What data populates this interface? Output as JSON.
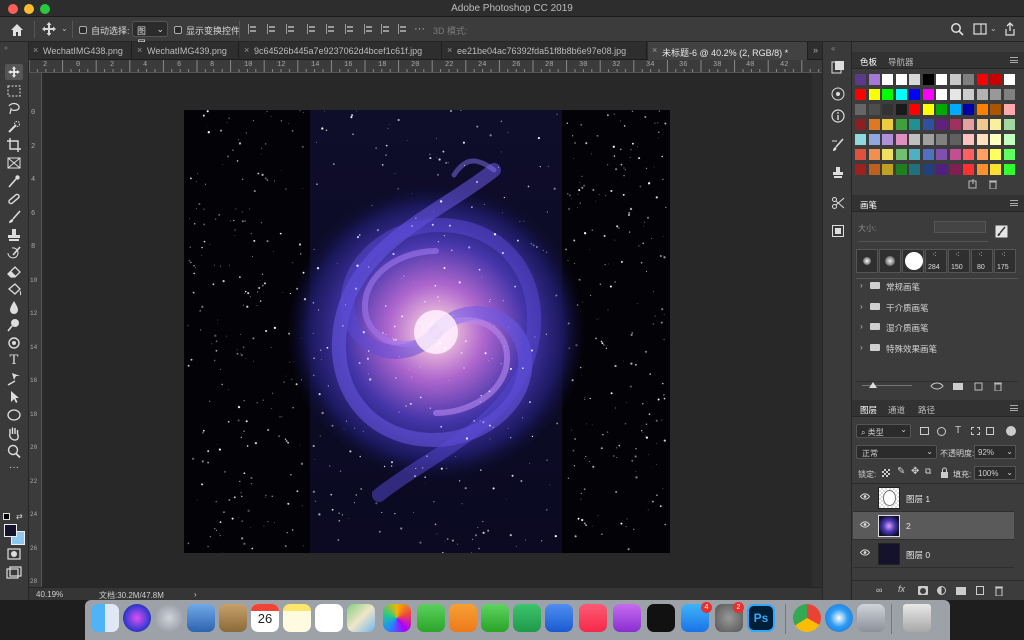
{
  "window": {
    "title": "Adobe Photoshop CC 2019"
  },
  "options_bar": {
    "auto_select_label": "自动选择:",
    "auto_select_value": "图层",
    "show_transform_label": "显示变换控件",
    "mode_3d_label": "3D 模式:"
  },
  "tabs": [
    {
      "label": "WechatIMG438.png",
      "active": false
    },
    {
      "label": "WechatIMG439.png",
      "active": false
    },
    {
      "label": "9c64526b445a7e9237062d4bcef1c61f.jpg",
      "active": false
    },
    {
      "label": "ee21be04ac76392fda51f8b8b6e97e08.jpg",
      "active": false
    },
    {
      "label": "未标题-6 @ 40.2% (2, RGB/8) *",
      "active": true
    }
  ],
  "rulers": {
    "top": [
      "2",
      "0",
      "2",
      "4",
      "6",
      "8",
      "10",
      "12",
      "14",
      "16",
      "18",
      "20",
      "22",
      "24",
      "26",
      "28",
      "30",
      "32",
      "34",
      "36",
      "38",
      "40",
      "42"
    ],
    "left": [
      "0",
      "2",
      "4",
      "6",
      "8",
      "10",
      "12",
      "14",
      "16",
      "18",
      "20",
      "22",
      "24",
      "26",
      "28"
    ]
  },
  "status": {
    "zoom": "40.19%",
    "doc_label": "文档:30.2M/47.8M"
  },
  "swatches_panel": {
    "tabs": [
      "色板",
      "导航器"
    ],
    "colors": [
      [
        "#5b3a8c",
        "#a478d8",
        "#ffffff",
        "#ffffff",
        "#d9d9d9",
        "#000000",
        "#ffffff",
        "#c8c8c8",
        "#7f7f7f",
        "#ff0000",
        "#c80000",
        "#ffffff"
      ],
      [
        "#ff0000",
        "#ffff00",
        "#00ff00",
        "#00ffff",
        "#0000ff",
        "#ff00ff",
        "#ffffff",
        "#e6e6e6",
        "#cccccc",
        "#b3b3b3",
        "#999999",
        "#808080"
      ],
      [
        "#666666",
        "#4d4d4d",
        "#333333",
        "#1a1a1a",
        "#ff0000",
        "#ffff00",
        "#00aa00",
        "#00aaff",
        "#0000aa",
        "#ff7f00",
        "#aa5500",
        "#ffaaaa"
      ],
      [
        "#8c2020",
        "#e07820",
        "#eecc40",
        "#40a040",
        "#209090",
        "#3050a0",
        "#602080",
        "#a03060",
        "#e4a0a0",
        "#f0c890",
        "#f8f0a0",
        "#a0d8a0"
      ],
      [
        "#90d8e0",
        "#90a8e0",
        "#b090d8",
        "#e090c0",
        "#c0c0c0",
        "#a0a0a0",
        "#808080",
        "#606060",
        "#ffc0c0",
        "#ffe0c0",
        "#ffffc0",
        "#c0ffc0"
      ],
      [
        "#e05040",
        "#f09050",
        "#f0e060",
        "#70c070",
        "#50b0c0",
        "#5070c0",
        "#8050b0",
        "#c05090",
        "#ff6060",
        "#ffa060",
        "#ffff60",
        "#60ff60"
      ],
      [
        "#a02020",
        "#c06020",
        "#c0a020",
        "#208020",
        "#207080",
        "#204080",
        "#502080",
        "#802050",
        "#ff3030",
        "#ff9030",
        "#ffe030",
        "#30ff30"
      ]
    ]
  },
  "brush_panel": {
    "tab": "画笔",
    "size_label": "大小:",
    "presets": [
      "",
      "",
      "",
      "284",
      "150",
      "80",
      "175"
    ],
    "groups": [
      "常规画笔",
      "干介质画笔",
      "湿介质画笔",
      "特殊效果画笔"
    ]
  },
  "layers_panel": {
    "tabs": [
      "图层",
      "通道",
      "路径"
    ],
    "filter_label": "类型",
    "blend_mode": "正常",
    "opacity_label": "不透明度:",
    "opacity_value": "92%",
    "lock_label": "锁定:",
    "fill_label": "填充:",
    "fill_value": "100%",
    "layers": [
      {
        "name": "图层 1",
        "selected": false
      },
      {
        "name": "2",
        "selected": true
      },
      {
        "name": "图层 0",
        "selected": false
      }
    ]
  },
  "dock": {
    "calendar_day": "26",
    "badges": [
      "4",
      "2"
    ],
    "apps": [
      "finder",
      "siri",
      "launchpad",
      "preview",
      "contacts",
      "calendar",
      "notes",
      "reminders",
      "maps",
      "photos",
      "messages",
      "pages",
      "facetime",
      "numbers",
      "keynote",
      "music",
      "podcasts",
      "apple-tv",
      "app-store",
      "system-preferences",
      "photoshop",
      "chrome",
      "safari",
      "archive-utility",
      "trash"
    ]
  }
}
